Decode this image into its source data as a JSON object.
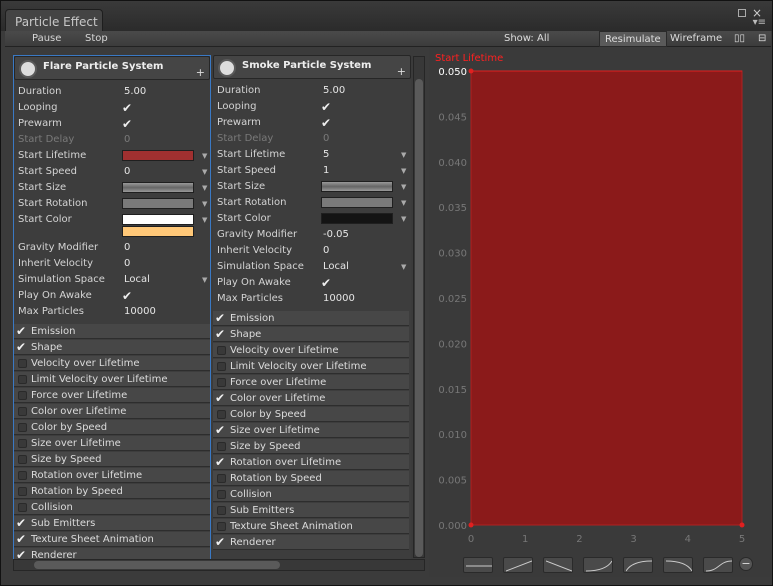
{
  "window": {
    "title": "Particle Effect"
  },
  "toolbar": {
    "pause_label": "Pause",
    "stop_label": "Stop",
    "show_label": "Show: All",
    "resimulate_label": "Resimulate",
    "wireframe_label": "Wireframe"
  },
  "systems": [
    {
      "name": "Flare Particle System",
      "props": {
        "duration": "5.00",
        "start_delay": "0",
        "start_speed": "0",
        "gravity_modifier": "0",
        "inherit_velocity": "0",
        "simulation_space": "Local",
        "max_particles": "10000"
      },
      "labels": {
        "duration": "Duration",
        "looping": "Looping",
        "prewarm": "Prewarm",
        "start_delay": "Start Delay",
        "start_lifetime": "Start Lifetime",
        "start_speed": "Start Speed",
        "start_size": "Start Size",
        "start_rotation": "Start Rotation",
        "start_color": "Start Color",
        "gravity_modifier": "Gravity Modifier",
        "inherit_velocity": "Inherit Velocity",
        "simulation_space": "Simulation Space",
        "play_on_awake": "Play On Awake",
        "max_particles": "Max Particles"
      },
      "modules": [
        {
          "label": "Emission",
          "checked": true
        },
        {
          "label": "Shape",
          "checked": true
        },
        {
          "label": "Velocity over Lifetime",
          "checked": false
        },
        {
          "label": "Limit Velocity over Lifetime",
          "checked": false
        },
        {
          "label": "Force over Lifetime",
          "checked": false
        },
        {
          "label": "Color over Lifetime",
          "checked": false
        },
        {
          "label": "Color by Speed",
          "checked": false
        },
        {
          "label": "Size over Lifetime",
          "checked": false
        },
        {
          "label": "Size by Speed",
          "checked": false
        },
        {
          "label": "Rotation over Lifetime",
          "checked": false
        },
        {
          "label": "Rotation by Speed",
          "checked": false
        },
        {
          "label": "Collision",
          "checked": false
        },
        {
          "label": "Sub Emitters",
          "checked": true
        },
        {
          "label": "Texture Sheet Animation",
          "checked": true
        },
        {
          "label": "Renderer",
          "checked": true
        }
      ]
    },
    {
      "name": "Smoke Particle System",
      "props": {
        "duration": "5.00",
        "start_delay": "0",
        "start_lifetime": "5",
        "start_speed": "1",
        "gravity_modifier": "-0.05",
        "inherit_velocity": "0",
        "simulation_space": "Local",
        "max_particles": "10000"
      },
      "labels": {
        "duration": "Duration",
        "looping": "Looping",
        "prewarm": "Prewarm",
        "start_delay": "Start Delay",
        "start_lifetime": "Start Lifetime",
        "start_speed": "Start Speed",
        "start_size": "Start Size",
        "start_rotation": "Start Rotation",
        "start_color": "Start Color",
        "gravity_modifier": "Gravity Modifier",
        "inherit_velocity": "Inherit Velocity",
        "simulation_space": "Simulation Space",
        "play_on_awake": "Play On Awake",
        "max_particles": "Max Particles"
      },
      "modules": [
        {
          "label": "Emission",
          "checked": true
        },
        {
          "label": "Shape",
          "checked": true
        },
        {
          "label": "Velocity over Lifetime",
          "checked": false
        },
        {
          "label": "Limit Velocity over Lifetime",
          "checked": false
        },
        {
          "label": "Force over Lifetime",
          "checked": false
        },
        {
          "label": "Color over Lifetime",
          "checked": true
        },
        {
          "label": "Color by Speed",
          "checked": false
        },
        {
          "label": "Size over Lifetime",
          "checked": true
        },
        {
          "label": "Size by Speed",
          "checked": false
        },
        {
          "label": "Rotation over Lifetime",
          "checked": true
        },
        {
          "label": "Rotation by Speed",
          "checked": false
        },
        {
          "label": "Collision",
          "checked": false
        },
        {
          "label": "Sub Emitters",
          "checked": false
        },
        {
          "label": "Texture Sheet Animation",
          "checked": false
        },
        {
          "label": "Renderer",
          "checked": true
        }
      ]
    }
  ],
  "curve": {
    "title": "Start Lifetime",
    "color": "#8b1a1a",
    "title_color": "#ff2020",
    "y_ticks": [
      "0.050",
      "0.045",
      "0.040",
      "0.035",
      "0.030",
      "0.025",
      "0.020",
      "0.015",
      "0.010",
      "0.005",
      "0.000"
    ],
    "x_ticks": [
      "0",
      "1",
      "2",
      "3",
      "4",
      "5"
    ]
  },
  "colors": {
    "flare_lifetime": "#a03030",
    "flare_color_top": "#ffffff",
    "flare_color_bottom": "#ffc878",
    "smoke_color": "#141414"
  }
}
